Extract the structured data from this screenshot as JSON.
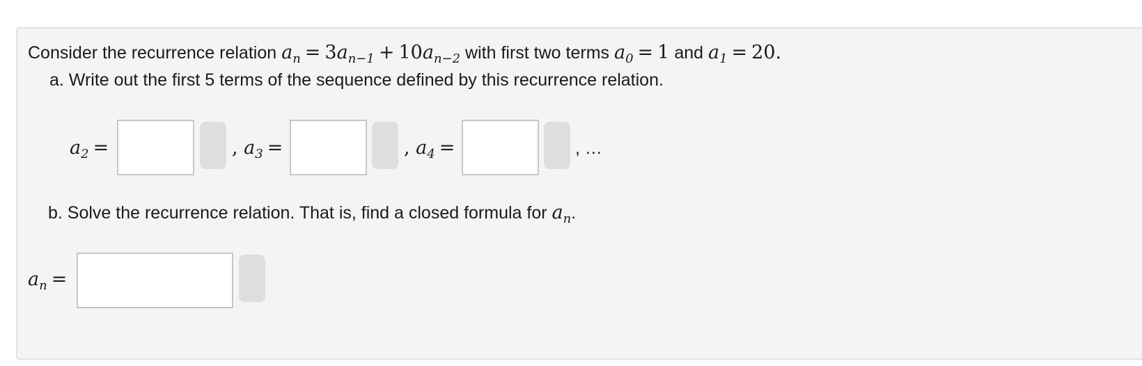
{
  "question": {
    "intro": "Consider the recurrence relation",
    "recurrence_lhs": "a",
    "recurrence_lhs_sub": "n",
    "recurrence_rhs_coef1": "3",
    "recurrence_rhs_term1_sub": "n−1",
    "recurrence_rhs_coef2": "10",
    "recurrence_rhs_term2_sub": "n−2",
    "middle_text": "with first two terms",
    "a0_sub": "0",
    "a0_value": "1",
    "and_text": "and",
    "a1_sub": "1",
    "a1_value": "20."
  },
  "part_a": {
    "label": "a. Write out the first 5 terms of the sequence defined by this recurrence relation.",
    "a2_sub": "2",
    "a3_sub": "3",
    "a4_sub": "4",
    "a2_value": "",
    "a3_value": "",
    "a4_value": "",
    "ellipsis": "…"
  },
  "part_b": {
    "label": "b. Solve the recurrence relation. That is, find a closed formula for",
    "an_sub": "n",
    "answer_value": ""
  },
  "colors": {
    "panel_bg": "#f4f4f4",
    "panel_border": "#e1e1e1",
    "input_border": "#c6c6c6",
    "check_button": "#dedede"
  }
}
